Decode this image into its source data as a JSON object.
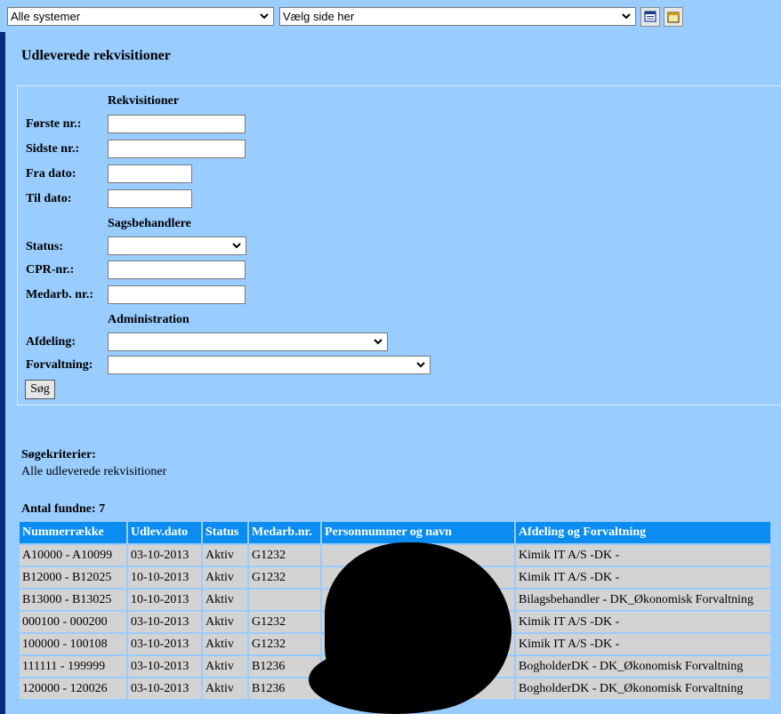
{
  "topbar": {
    "system_select": "Alle systemer",
    "page_select": "Vælg side her"
  },
  "page": {
    "title": "Udleverede rekvisitioner"
  },
  "form": {
    "section_rekvisitioner": "Rekvisitioner",
    "first_nr_label": "Første nr.:",
    "last_nr_label": "Sidste nr.:",
    "from_date_label": "Fra dato:",
    "to_date_label": "Til dato:",
    "section_sagsbehandlere": "Sagsbehandlere",
    "status_label": "Status:",
    "cpr_label": "CPR-nr.:",
    "medarb_label": "Medarb. nr.:",
    "section_administration": "Administration",
    "afdeling_label": "Afdeling:",
    "forvaltning_label": "Forvaltning:",
    "search_button": "Søg"
  },
  "results": {
    "criteria_label": "Søgekriterier:",
    "criteria_value": "Alle udleverede rekvisitioner",
    "count_label": "Antal fundne: 7",
    "columns": [
      "Nummerrække",
      "Udlev.dato",
      "Status",
      "Medarb.nr.",
      "Personnummer og navn",
      "Afdeling og Forvaltning"
    ],
    "rows": [
      [
        "A10000 - A10099",
        "03-10-2013",
        "Aktiv",
        "G1232",
        "",
        "Kimik IT A/S -DK -"
      ],
      [
        "B12000 - B12025",
        "10-10-2013",
        "Aktiv",
        "G1232",
        "",
        "Kimik IT A/S -DK -"
      ],
      [
        "B13000 - B13025",
        "10-10-2013",
        "Aktiv",
        "",
        "",
        "Bilagsbehandler - DK_Økonomisk Forvaltning"
      ],
      [
        "000100 - 000200",
        "03-10-2013",
        "Aktiv",
        "G1232",
        "",
        "Kimik IT A/S -DK -"
      ],
      [
        "100000 - 100108",
        "03-10-2013",
        "Aktiv",
        "G1232",
        "",
        "Kimik IT A/S -DK -"
      ],
      [
        "111111 - 199999",
        "03-10-2013",
        "Aktiv",
        "B1236",
        "",
        "BogholderDK - DK_Økonomisk Forvaltning"
      ],
      [
        "120000 - 120026",
        "03-10-2013",
        "Aktiv",
        "B1236",
        "",
        "BogholderDK - DK_Økonomisk Forvaltning"
      ]
    ]
  }
}
